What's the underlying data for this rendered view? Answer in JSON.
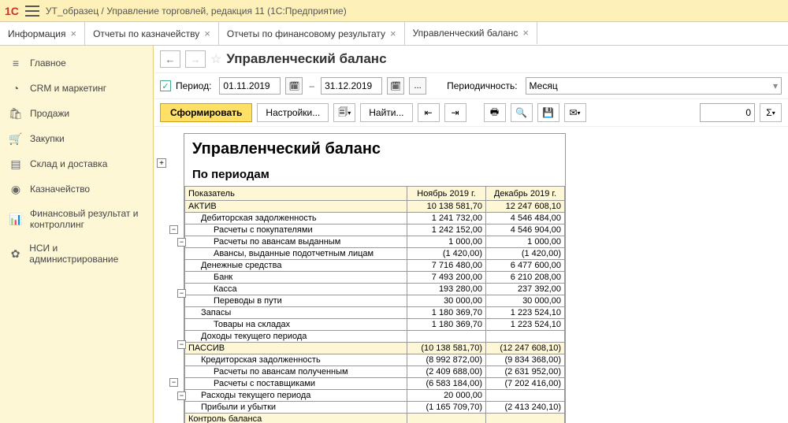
{
  "title": "УТ_образец / Управление торговлей, редакция 11  (1С:Предприятие)",
  "tabs": [
    {
      "label": "Информация",
      "active": false
    },
    {
      "label": "Отчеты по казначейству",
      "active": false
    },
    {
      "label": "Отчеты по финансовому результату",
      "active": false
    },
    {
      "label": "Управленческий баланс",
      "active": true
    }
  ],
  "sidebar": [
    {
      "icon": "home",
      "label": "Главное"
    },
    {
      "icon": "crm",
      "label": "CRM и маркетинг"
    },
    {
      "icon": "sales",
      "label": "Продажи"
    },
    {
      "icon": "cart",
      "label": "Закупки"
    },
    {
      "icon": "stock",
      "label": "Склад и доставка"
    },
    {
      "icon": "money",
      "label": "Казначейство"
    },
    {
      "icon": "chart",
      "label": "Финансовый результат и контроллинг"
    },
    {
      "icon": "gear",
      "label": "НСИ и администрирование"
    }
  ],
  "report_header": "Управленческий баланс",
  "period": {
    "label": "Период:",
    "from": "01.11.2019",
    "to": "31.12.2019",
    "periodicity_label": "Периодичность:",
    "periodicity_value": "Месяц"
  },
  "toolbar": {
    "form": "Сформировать",
    "settings": "Настройки...",
    "find": "Найти...",
    "counter": "0"
  },
  "report": {
    "title": "Управленческий баланс",
    "subtitle": "По периодам",
    "columns": [
      "Показатель",
      "Ноябрь 2019 г.",
      "Декабрь 2019 г."
    ],
    "rows": [
      {
        "level": 0,
        "label": "АКТИВ",
        "v1": "10 138 581,70",
        "v2": "12 247 608,10"
      },
      {
        "level": 1,
        "label": "Дебиторская задолженность",
        "v1": "1 241 732,00",
        "v2": "4 546 484,00"
      },
      {
        "level": 2,
        "label": "Расчеты с покупателями",
        "v1": "1 242 152,00",
        "v2": "4 546 904,00"
      },
      {
        "level": 2,
        "label": "Расчеты по авансам выданным",
        "v1": "1 000,00",
        "v2": "1 000,00"
      },
      {
        "level": 2,
        "label": "Авансы, выданные подотчетным лицам",
        "v1": "(1 420,00)",
        "v2": "(1 420,00)"
      },
      {
        "level": 1,
        "label": "Денежные средства",
        "v1": "7 716 480,00",
        "v2": "6 477 600,00"
      },
      {
        "level": 2,
        "label": "Банк",
        "v1": "7 493 200,00",
        "v2": "6 210 208,00"
      },
      {
        "level": 2,
        "label": "Касса",
        "v1": "193 280,00",
        "v2": "237 392,00"
      },
      {
        "level": 2,
        "label": "Переводы в пути",
        "v1": "30 000,00",
        "v2": "30 000,00"
      },
      {
        "level": 1,
        "label": "Запасы",
        "v1": "1 180 369,70",
        "v2": "1 223 524,10"
      },
      {
        "level": 2,
        "label": "Товары на складах",
        "v1": "1 180 369,70",
        "v2": "1 223 524,10"
      },
      {
        "level": 1,
        "label": "Доходы текущего периода",
        "v1": "",
        "v2": ""
      },
      {
        "level": 0,
        "label": "ПАССИВ",
        "v1": "(10 138 581,70)",
        "v2": "(12 247 608,10)"
      },
      {
        "level": 1,
        "label": "Кредиторская задолженность",
        "v1": "(8 992 872,00)",
        "v2": "(9 834 368,00)"
      },
      {
        "level": 2,
        "label": "Расчеты по авансам полученным",
        "v1": "(2 409 688,00)",
        "v2": "(2 631 952,00)"
      },
      {
        "level": 2,
        "label": "Расчеты с поставщиками",
        "v1": "(6 583 184,00)",
        "v2": "(7 202 416,00)"
      },
      {
        "level": 1,
        "label": "Расходы текущего периода",
        "v1": "20 000,00",
        "v2": ""
      },
      {
        "level": 1,
        "label": "Прибыли и убытки",
        "v1": "(1 165 709,70)",
        "v2": "(2 413 240,10)"
      }
    ],
    "footer_label": "Контроль баланса"
  },
  "chart_data": {
    "type": "table",
    "title": "Управленческий баланс — По периодам",
    "columns": [
      "Показатель",
      "Ноябрь 2019 г.",
      "Декабрь 2019 г."
    ],
    "series": [
      {
        "name": "АКТИВ",
        "values": [
          10138581.7,
          12247608.1
        ]
      },
      {
        "name": "Дебиторская задолженность",
        "values": [
          1241732.0,
          4546484.0
        ]
      },
      {
        "name": "Расчеты с покупателями",
        "values": [
          1242152.0,
          4546904.0
        ]
      },
      {
        "name": "Расчеты по авансам выданным",
        "values": [
          1000.0,
          1000.0
        ]
      },
      {
        "name": "Авансы, выданные подотчетным лицам",
        "values": [
          -1420.0,
          -1420.0
        ]
      },
      {
        "name": "Денежные средства",
        "values": [
          7716480.0,
          6477600.0
        ]
      },
      {
        "name": "Банк",
        "values": [
          7493200.0,
          6210208.0
        ]
      },
      {
        "name": "Касса",
        "values": [
          193280.0,
          237392.0
        ]
      },
      {
        "name": "Переводы в пути",
        "values": [
          30000.0,
          30000.0
        ]
      },
      {
        "name": "Запасы",
        "values": [
          1180369.7,
          1223524.1
        ]
      },
      {
        "name": "Товары на складах",
        "values": [
          1180369.7,
          1223524.1
        ]
      },
      {
        "name": "Доходы текущего периода",
        "values": [
          null,
          null
        ]
      },
      {
        "name": "ПАССИВ",
        "values": [
          -10138581.7,
          -12247608.1
        ]
      },
      {
        "name": "Кредиторская задолженность",
        "values": [
          -8992872.0,
          -9834368.0
        ]
      },
      {
        "name": "Расчеты по авансам полученным",
        "values": [
          -2409688.0,
          -2631952.0
        ]
      },
      {
        "name": "Расчеты с поставщиками",
        "values": [
          -6583184.0,
          -7202416.0
        ]
      },
      {
        "name": "Расходы текущего периода",
        "values": [
          20000.0,
          null
        ]
      },
      {
        "name": "Прибыли и убытки",
        "values": [
          -1165709.7,
          -2413240.1
        ]
      }
    ]
  },
  "icons": {
    "home": "≡",
    "crm": "◔",
    "sales": "🛍",
    "cart": "🛒",
    "stock": "▤",
    "money": "●",
    "chart": "▮",
    "gear": "✿"
  }
}
